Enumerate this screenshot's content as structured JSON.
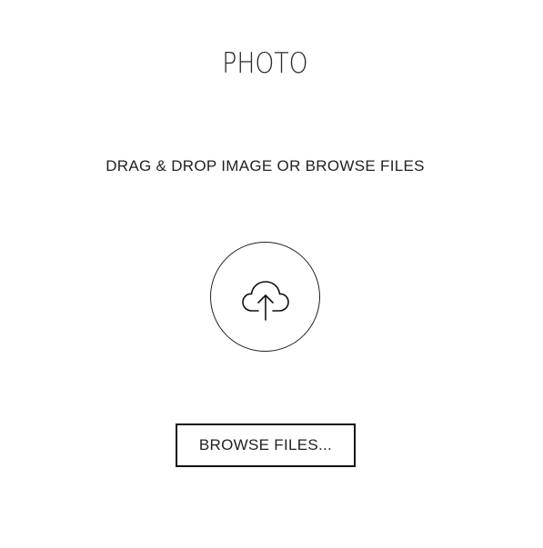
{
  "title": "PHOTO",
  "instructions": "DRAG & DROP IMAGE OR BROWSE FILES",
  "upload_icon": "cloud-upload-icon",
  "browse_button_label": "BROWSE FILES...",
  "colors": {
    "background": "#ffffff",
    "text": "#222222",
    "border": "#111111"
  }
}
